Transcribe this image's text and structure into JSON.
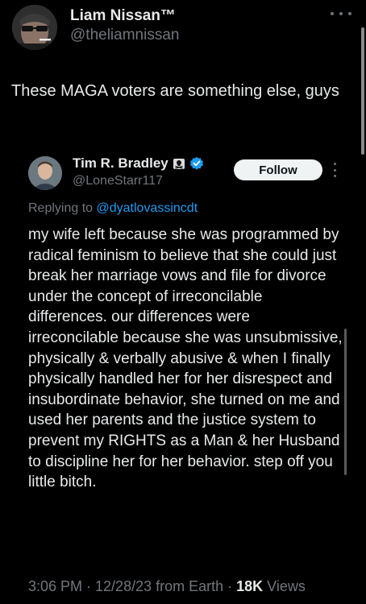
{
  "outer": {
    "display_name": "Liam Nissan™",
    "handle": "@theliamnissan",
    "text": "These MAGA voters are something else, guys"
  },
  "inner": {
    "display_name": "Tim R. Bradley",
    "handle": "@LoneStarr117",
    "follow_label": "Follow",
    "replying_prefix": "Replying to ",
    "replying_handle": "@dyatlovassincdt",
    "text": "my wife left because she was programmed by radical feminism to believe that she could just break her marriage vows and file for divorce under the concept of irreconcilable differences. our differences were irreconcilable because she was unsubmissive, physically & verbally abusive & when I finally physically handled her for her disrespect and insubordinate behavior, she turned on me and used her parents and the justice system to prevent my RIGHTS as a Man & her Husband to discipline her for her behavior. step off you little bitch.",
    "timestamp": "3:06 PM · 12/28/23 from Earth · ",
    "views_count": "18K",
    "views_label": " Views"
  },
  "colors": {
    "background": "#000000",
    "text_primary": "#e7e9ea",
    "text_secondary": "#71767b",
    "link": "#1d9bf0",
    "verified": "#1d9bf0"
  }
}
